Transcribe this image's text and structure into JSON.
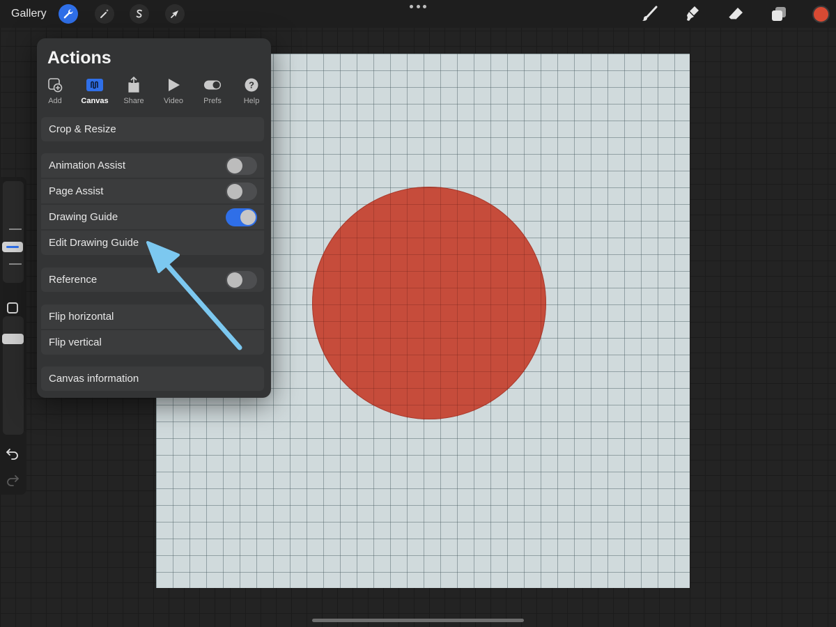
{
  "topbar": {
    "gallery_label": "Gallery",
    "tools_left": [
      "wrench-icon",
      "magic-wand-icon",
      "selection-s-icon",
      "transform-arrow-icon"
    ],
    "tools_right": [
      "brush-icon",
      "smudge-icon",
      "eraser-icon",
      "layers-icon"
    ],
    "current_color": "#d84a33"
  },
  "actions": {
    "title": "Actions",
    "tabs": [
      {
        "label": "Add",
        "icon": "add-image-icon"
      },
      {
        "label": "Canvas",
        "icon": "canvas-icon",
        "active": true
      },
      {
        "label": "Share",
        "icon": "share-icon"
      },
      {
        "label": "Video",
        "icon": "play-icon"
      },
      {
        "label": "Prefs",
        "icon": "toggle-icon"
      },
      {
        "label": "Help",
        "icon": "help-icon"
      }
    ],
    "crop_resize": "Crop & Resize",
    "animation_assist": "Animation Assist",
    "page_assist": "Page Assist",
    "drawing_guide": "Drawing Guide",
    "edit_drawing_guide": "Edit Drawing Guide",
    "reference": "Reference",
    "flip_horizontal": "Flip horizontal",
    "flip_vertical": "Flip vertical",
    "canvas_information": "Canvas information",
    "toggles": {
      "animation_assist": false,
      "page_assist": false,
      "drawing_guide": true,
      "reference": false
    }
  },
  "colors": {
    "accent": "#2f6fe8",
    "circle": "#c64634",
    "annotation_arrow": "#7cc8f0"
  }
}
